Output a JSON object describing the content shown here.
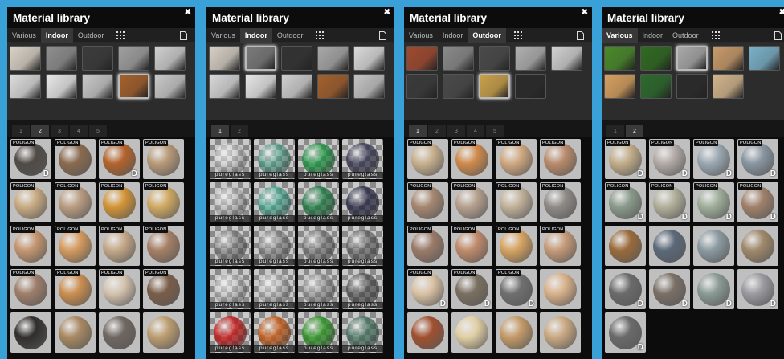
{
  "panels": [
    {
      "title": "Material library",
      "tabs": [
        "Various",
        "Indoor",
        "Outdoor"
      ],
      "active_tab": 1,
      "icons": [
        "grid-icon",
        "document-icon"
      ],
      "categories": [
        "#d9d2c6",
        "#8f8f8f",
        "#3b3b3b",
        "#a0a0a0",
        "#cfcfcf",
        "#dcdcdc",
        "#e8e8e8",
        "#c8c8c8",
        "#a3602d",
        "#c9c9c9"
      ],
      "selected_category": 8,
      "pages": [
        "1",
        "2",
        "3",
        "4",
        "5"
      ],
      "active_page": 1,
      "tiles": [
        {
          "c": "#4f4a44",
          "logo": "POLIGON",
          "d": "D"
        },
        {
          "c": "#8a6a4e",
          "logo": "POLIGON"
        },
        {
          "c": "#b4622a",
          "logo": "POLIGON",
          "d": "D"
        },
        {
          "c": "#b89a78",
          "logo": "POLIGON"
        },
        {
          "c": "#c8ab83",
          "logo": "POLIGON"
        },
        {
          "c": "#b99c80",
          "logo": "POLIGON"
        },
        {
          "c": "#d39435",
          "logo": "POLIGON"
        },
        {
          "c": "#d0a962",
          "logo": "POLIGON"
        },
        {
          "c": "#c49670",
          "logo": "POLIGON"
        },
        {
          "c": "#d59a5e",
          "logo": "POLIGON"
        },
        {
          "c": "#c4a888",
          "logo": "POLIGON"
        },
        {
          "c": "#a67f65",
          "logo": "POLIGON"
        },
        {
          "c": "#9e7e6a",
          "logo": "POLIGON"
        },
        {
          "c": "#cc8e50",
          "logo": "POLIGON"
        },
        {
          "c": "#d3c2ae",
          "logo": "POLIGON"
        },
        {
          "c": "#7a5d48",
          "logo": "POLIGON"
        },
        {
          "c": "#2f2e2c"
        },
        {
          "c": "#a88962"
        },
        {
          "c": "#6f6660"
        },
        {
          "c": "#bc9d70"
        }
      ]
    },
    {
      "title": "Material library",
      "tabs": [
        "Various",
        "Indoor",
        "Outdoor"
      ],
      "active_tab": 1,
      "icons": [
        "grid-icon",
        "document-icon"
      ],
      "categories": [
        "#d6cfc4",
        "#7a7a7a",
        "#333333",
        "#a8a8a8",
        "#dadada",
        "#d8d8d8",
        "#e6e6e6",
        "#cfcfcf",
        "#a3602d",
        "#c4c4c4"
      ],
      "selected_category": 1,
      "pages": [
        "1",
        "2"
      ],
      "active_page": 0,
      "tiles": [
        {
          "c": "rgba(235,235,235,0.35)",
          "g": "pureglass"
        },
        {
          "c": "rgba(60,160,130,0.55)",
          "g": "pureglass"
        },
        {
          "c": "rgba(20,150,60,0.75)",
          "g": "pureglass"
        },
        {
          "c": "rgba(40,40,70,0.7)",
          "g": "pureglass"
        },
        {
          "c": "rgba(200,200,200,0.35)",
          "g": "pureglass"
        },
        {
          "c": "rgba(40,170,140,0.55)",
          "g": "pureglass"
        },
        {
          "c": "rgba(20,120,60,0.75)",
          "g": "pureglass"
        },
        {
          "c": "rgba(30,30,60,0.75)",
          "g": "pureglass"
        },
        {
          "c": "rgba(110,110,110,0.5)",
          "g": "pureglass"
        },
        {
          "c": "rgba(120,120,120,0.5)",
          "g": "pureglass"
        },
        {
          "c": "rgba(100,100,100,0.55)",
          "g": "pureglass"
        },
        {
          "c": "rgba(80,80,80,0.55)",
          "g": "pureglass"
        },
        {
          "c": "rgba(220,220,220,0.35)",
          "g": "pureglass"
        },
        {
          "c": "rgba(200,200,200,0.35)",
          "g": "pureglass"
        },
        {
          "c": "rgba(140,140,140,0.5)",
          "g": "pureglass"
        },
        {
          "c": "rgba(60,60,60,0.6)",
          "g": "pureglass"
        },
        {
          "c": "rgba(200,20,20,0.8)",
          "g": "pureglass"
        },
        {
          "c": "rgba(200,90,20,0.8)",
          "g": "pureglass"
        },
        {
          "c": "rgba(40,150,30,0.8)",
          "g": "pureglass"
        },
        {
          "c": "rgba(60,110,90,0.7)",
          "g": "pureglass"
        }
      ]
    },
    {
      "title": "Material library",
      "tabs": [
        "Various",
        "Indoor",
        "Outdoor"
      ],
      "active_tab": 2,
      "icons": [
        "grid-icon",
        "document-icon"
      ],
      "categories": [
        "#a04a30",
        "#8a8a8a",
        "#4a4a4a",
        "#b0b0b0",
        "#d0d0d0",
        "#3a3a3a",
        "#4a4a4a",
        "#c9a04a",
        "#2a2a2a",
        "#0c0c0c"
      ],
      "selected_category": 7,
      "pages": [
        "1",
        "2",
        "3",
        "4",
        "5"
      ],
      "active_page": 0,
      "tiles": [
        {
          "c": "#c7b08e",
          "logo": "POLIGON"
        },
        {
          "c": "#d08a4a",
          "logo": "POLIGON"
        },
        {
          "c": "#d0a880",
          "logo": "POLIGON"
        },
        {
          "c": "#b98a6a",
          "logo": "POLIGON"
        },
        {
          "c": "#a58770",
          "logo": "POLIGON"
        },
        {
          "c": "#b5a08d",
          "logo": "POLIGON"
        },
        {
          "c": "#c2b19a",
          "logo": "POLIGON"
        },
        {
          "c": "#8e8a86",
          "logo": "POLIGON"
        },
        {
          "c": "#9a7a68",
          "logo": "POLIGON"
        },
        {
          "c": "#c08a6a",
          "logo": "POLIGON"
        },
        {
          "c": "#d6a360",
          "logo": "POLIGON"
        },
        {
          "c": "#c59a78",
          "logo": "POLIGON"
        },
        {
          "c": "#d9c2a4",
          "logo": "POLIGON",
          "d": "D"
        },
        {
          "c": "#7a6f60",
          "logo": "POLIGON",
          "d": "D"
        },
        {
          "c": "#6f6f6f",
          "logo": "POLIGON",
          "d": "D"
        },
        {
          "c": "#d9b18a"
        },
        {
          "c": "#a0502e"
        },
        {
          "c": "#e0cfa4"
        },
        {
          "c": "#c49a68"
        },
        {
          "c": "#c9a882"
        }
      ]
    },
    {
      "title": "Material library",
      "tabs": [
        "Various",
        "Indoor",
        "Outdoor"
      ],
      "active_tab": 0,
      "icons": [
        "grid-icon",
        "document-icon"
      ],
      "categories": [
        "#4a8a2a",
        "#2f6a20",
        "#a8a8a8",
        "#c89a6a",
        "#7ab0c8",
        "#d6a060",
        "#2c6a2c",
        "#2a2a2a",
        "#d2b48c",
        "#0c0c0c"
      ],
      "selected_category": 2,
      "pages": [
        "1",
        "2"
      ],
      "active_page": 1,
      "tiles": [
        {
          "c": "#c2ad8a",
          "logo": "POLIGON",
          "d": "D"
        },
        {
          "c": "#b2aaa6",
          "logo": "POLIGON",
          "d": "D"
        },
        {
          "c": "#9aa8b2",
          "logo": "POLIGON",
          "d": "D"
        },
        {
          "c": "#8895a0",
          "logo": "POLIGON",
          "d": "D"
        },
        {
          "c": "#8a9a8a",
          "logo": "POLIGON",
          "d": "D"
        },
        {
          "c": "#b2b09a",
          "logo": "POLIGON",
          "d": "D"
        },
        {
          "c": "#9fae9a",
          "logo": "POLIGON",
          "d": "D"
        },
        {
          "c": "#a0806a",
          "logo": "POLIGON",
          "d": "D"
        },
        {
          "c": "#9a6a3a"
        },
        {
          "c": "#5a6878"
        },
        {
          "c": "#8a9aa0"
        },
        {
          "c": "#a0886a"
        },
        {
          "c": "#6a6a6a",
          "d": "D"
        },
        {
          "c": "#7a6f66",
          "d": "D"
        },
        {
          "c": "#8a9a94",
          "d": "D"
        },
        {
          "c": "#9a9aa0",
          "d": "D"
        },
        {
          "c": "#6a6a6a",
          "d": "D"
        }
      ]
    }
  ]
}
